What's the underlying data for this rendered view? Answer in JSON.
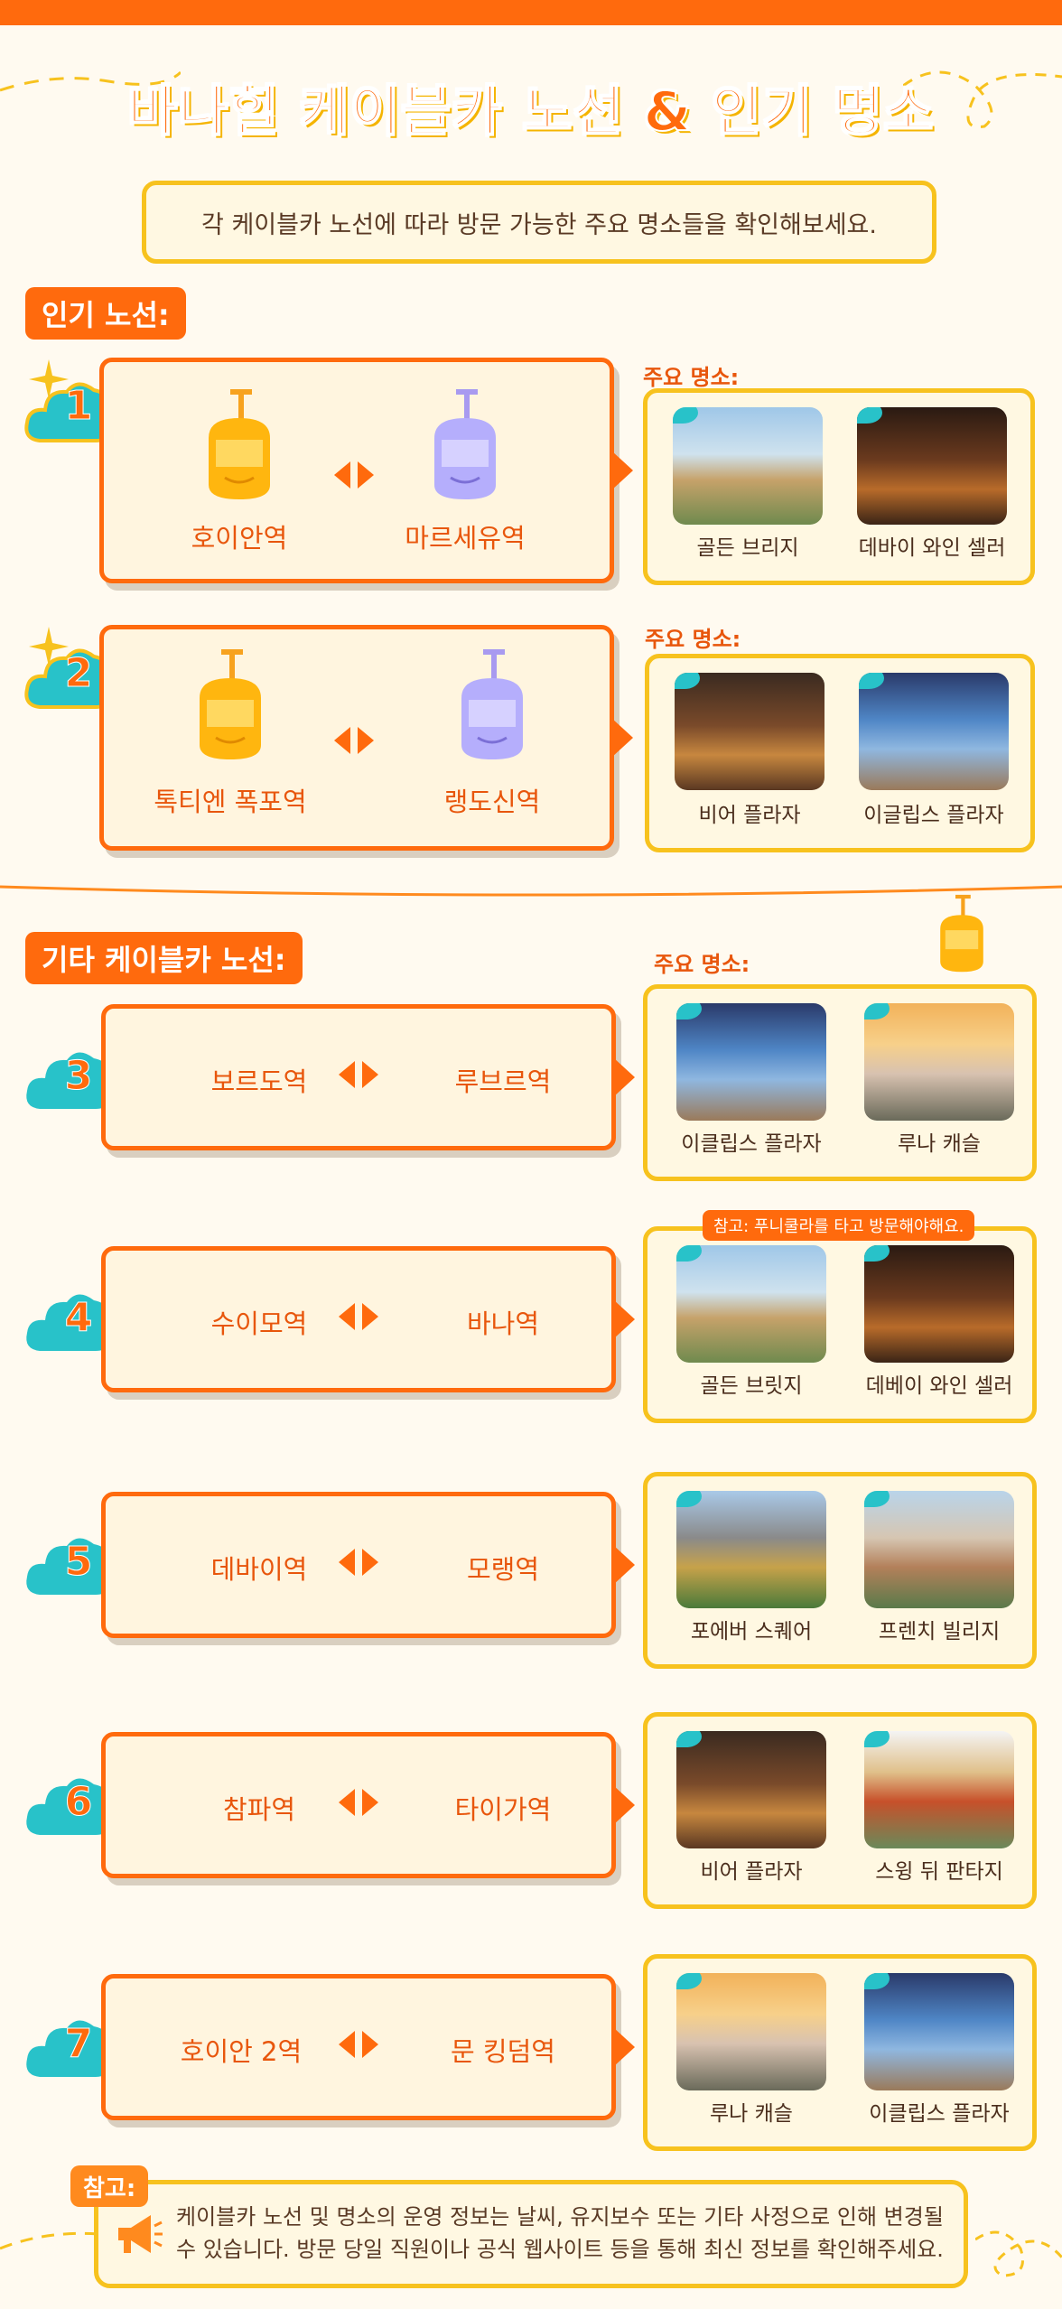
{
  "title": "바나힐 케이블카 노선 & 인기 명소",
  "subtitle": "각 케이블카 노선에 따라 방문 가능한 주요 명소들을 확인해보세요.",
  "popular_section_label": "인기 노선:",
  "other_section_label": "기타 케이블카 노선:",
  "spots_label": "주요 명소:",
  "routes": [
    {
      "num": "1",
      "from": "호이안역",
      "to": "마르세유역",
      "spots": [
        "골든 브리지",
        "데바이 와인 셀러"
      ]
    },
    {
      "num": "2",
      "from": "톡티엔 폭포역",
      "to": "랭도신역",
      "spots": [
        "비어 플라자",
        "이글립스 플라자"
      ]
    },
    {
      "num": "3",
      "from": "보르도역",
      "to": "루브르역",
      "spots": [
        "이클립스 플라자",
        "루나 캐슬"
      ]
    },
    {
      "num": "4",
      "from": "수이모역",
      "to": "바나역",
      "spots": [
        "골든 브릿지",
        "데베이 와인 셀러"
      ]
    },
    {
      "num": "5",
      "from": "데바이역",
      "to": "모랭역",
      "spots": [
        "포에버 스퀘어",
        "프렌치 빌리지"
      ]
    },
    {
      "num": "6",
      "from": "참파역",
      "to": "타이가역",
      "spots": [
        "비어 플라자",
        "스윙 뒤 판타지"
      ]
    },
    {
      "num": "7",
      "from": "호이안 2역",
      "to": "문 킹덤역",
      "spots": [
        "루나 캐슬",
        "이클립스 플라자"
      ]
    }
  ],
  "route4_note": "참고: 푸니쿨라를 타고 방문해야해요.",
  "bottom_note_label": "참고:",
  "bottom_note_text": "케이블카 노선 및 명소의 운영 정보는 날씨, 유지보수 또는 기타 사정으로 인해 변경될 수 있습니다. 방문 당일 직원이나 공식 웹사이트 등을 통해 최신 정보를 확인해주세요.",
  "icons": {
    "cloud": "cloud-icon",
    "gondola": "cable-car-icon",
    "swap": "bidirectional-arrow-icon",
    "megaphone": "megaphone-icon",
    "sparkle": "sparkle-icon"
  },
  "colors": {
    "accent": "#ff6a0d",
    "yellow": "#f7c21e",
    "teal": "#28c2c9",
    "cream": "#fff5df"
  }
}
